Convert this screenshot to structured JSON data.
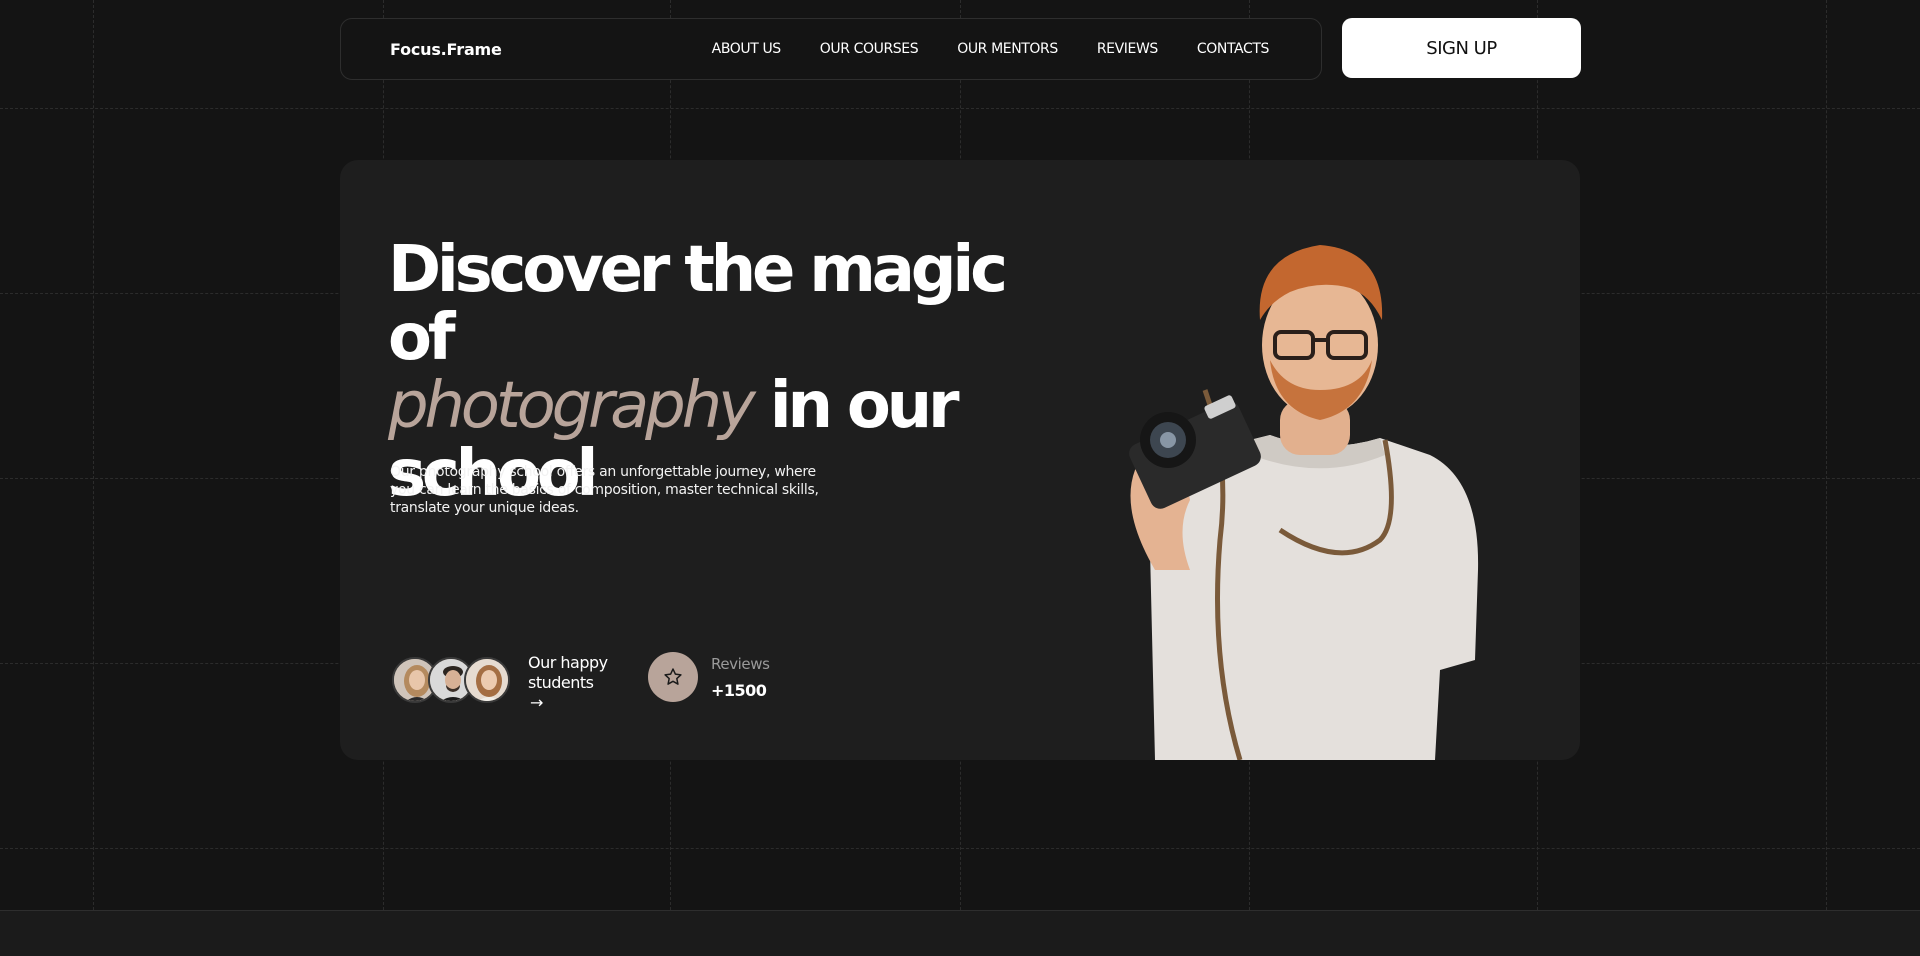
{
  "header": {
    "logo": "Focus.Frame",
    "nav": [
      "ABOUT US",
      "OUR COURSES",
      "OUR MENTORS",
      "REVIEWS",
      "CONTACTS"
    ],
    "signup": "SIGN UP"
  },
  "hero": {
    "headline_line1": "Discover the magic of",
    "headline_accent": "photography",
    "headline_line2_rest": " in our",
    "headline_line3": "school",
    "description": "Our photography school offers an unforgettable journey, where you can learn the basics of composition, master technical skills, translate your unique ideas.",
    "students_label_1": "Our happy",
    "students_label_2": "students",
    "students_arrow": "→",
    "reviews_label": "Reviews",
    "reviews_count": "+1500"
  },
  "icons": {
    "arrow": "arrow-right-icon",
    "star": "star-icon"
  },
  "colors": {
    "background": "#141414",
    "card": "#1e1e1e",
    "accent": "#b8a49a",
    "button": "#ffffff"
  }
}
